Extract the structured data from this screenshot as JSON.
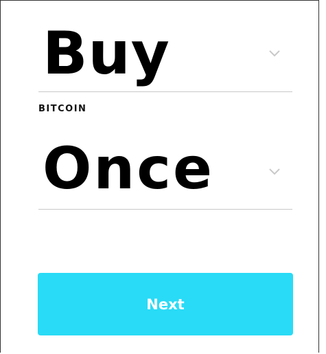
{
  "form": {
    "action_select": {
      "value": "Buy",
      "icon": "chevron-down-icon"
    },
    "asset_label": "BITCOIN",
    "frequency_select": {
      "value": "Once",
      "icon": "chevron-down-icon"
    },
    "next_button": {
      "label": "Next"
    }
  },
  "colors": {
    "accent": "#29dbf6",
    "divider": "#c8c8c8",
    "chevron": "#c9c9c9"
  }
}
